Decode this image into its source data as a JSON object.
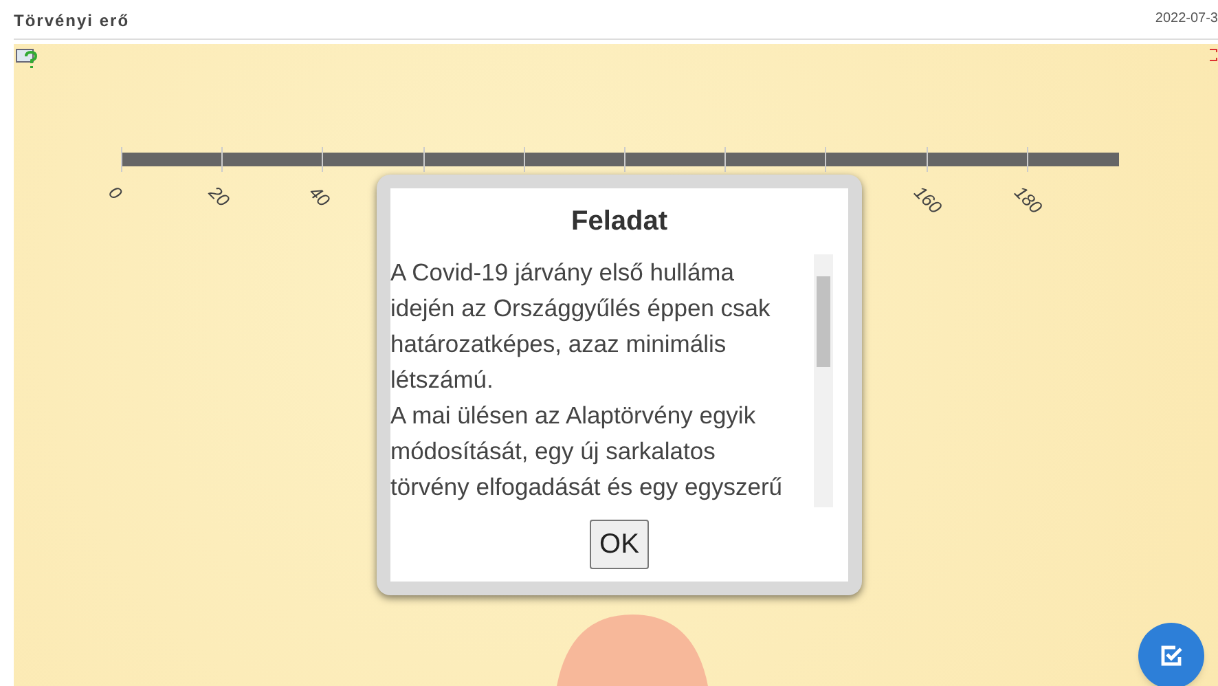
{
  "header": {
    "title": "Törvényi erő",
    "date": "2022-07-3"
  },
  "scale": {
    "left_labels": [
      "0",
      "20",
      "40"
    ],
    "right_labels": [
      "160",
      "180"
    ]
  },
  "dialog": {
    "title": "Feladat",
    "paragraphs": [
      "A Covid-19 járvány első hulláma idején az Országgyűlés éppen csak határozatképes, azaz minimális létszámú.",
      "A mai ülésen az Alaptörvény egyik módosítását, egy új sarkalatos törvény elfogadását és egy egyszerű"
    ],
    "button": "OK"
  }
}
